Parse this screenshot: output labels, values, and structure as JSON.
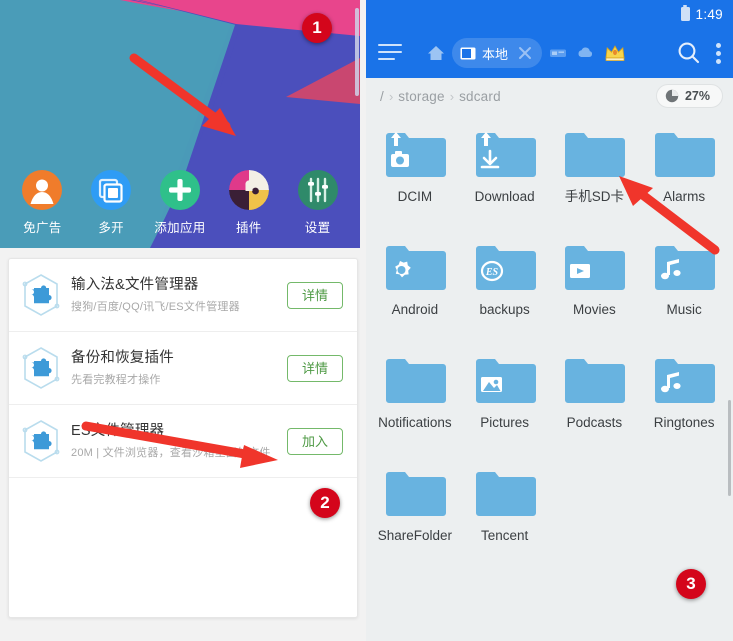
{
  "left_panel": {
    "hero": {
      "apps": [
        {
          "label": "免广告",
          "icon": "user-avatar-icon",
          "color": "#f07c2b"
        },
        {
          "label": "多开",
          "icon": "multi-window-icon",
          "color": "#2f9cf5"
        },
        {
          "label": "添加应用",
          "icon": "plus-icon",
          "color": "#2fc08a"
        },
        {
          "label": "插件",
          "icon": "puzzle-plugin-icon",
          "color": "#e0398a"
        },
        {
          "label": "设置",
          "icon": "sliders-settings-icon",
          "color": "#2f8a6a"
        }
      ],
      "annotation_badge": "1"
    },
    "plugin_list": {
      "items": [
        {
          "title": "输入法&文件管理器",
          "subtitle": "搜狗/百度/QQ/讯飞/ES文件管理器",
          "button": "详情",
          "icon": "hex-puzzle-plugin-icon"
        },
        {
          "title": "备份和恢复插件",
          "subtitle": "先看完教程才操作",
          "button": "详情",
          "icon": "hex-puzzle-plugin-icon"
        },
        {
          "title": "ES文件管理器",
          "subtitle": "20M | 文件浏览器，查看沙箱里面的文件",
          "button": "加入",
          "icon": "hex-puzzle-plugin-icon"
        }
      ],
      "annotation_badge": "2"
    }
  },
  "right_panel": {
    "statusbar": {
      "time": "1:49",
      "battery_icon": "battery-icon"
    },
    "toolbar": {
      "menu_icon": "hamburger-menu-icon",
      "home_icon": "home-icon",
      "tab": {
        "label": "本地",
        "icon": "device-local-icon",
        "close_icon": "close-icon"
      },
      "lan_icon": "network-lan-icon",
      "cloud_icon": "cloud-icon",
      "vip_icon": "crown-vip-icon",
      "search_icon": "search-icon",
      "more_icon": "more-vertical-icon"
    },
    "pathbar": {
      "crumbs": [
        "/",
        "storage",
        "sdcard"
      ],
      "separator": "›",
      "storage": {
        "percent": "27%",
        "icon": "pie-chart-icon"
      }
    },
    "files": [
      {
        "name": "DCIM",
        "icon": "folder-camera-icon"
      },
      {
        "name": "Download",
        "icon": "folder-download-icon"
      },
      {
        "name": "手机SD卡",
        "icon": "folder-icon"
      },
      {
        "name": "Alarms",
        "icon": "folder-icon"
      },
      {
        "name": "Android",
        "icon": "folder-gear-icon"
      },
      {
        "name": "backups",
        "icon": "folder-es-icon"
      },
      {
        "name": "Movies",
        "icon": "folder-video-icon"
      },
      {
        "name": "Music",
        "icon": "folder-music-icon"
      },
      {
        "name": "Notifications",
        "icon": "folder-icon"
      },
      {
        "name": "Pictures",
        "icon": "folder-image-icon"
      },
      {
        "name": "Podcasts",
        "icon": "folder-icon"
      },
      {
        "name": "Ringtones",
        "icon": "folder-music-icon"
      },
      {
        "name": "ShareFolder",
        "icon": "folder-icon"
      },
      {
        "name": "Tencent",
        "icon": "folder-icon"
      }
    ],
    "annotation_badge": "3"
  },
  "colors": {
    "accent_blue": "#1a73e8",
    "folder_blue": "#68b3e0",
    "badge_red": "#d4051b",
    "arrow_red": "#f0352b",
    "button_green": "#4f9a45",
    "hero_purple": "#4b4fbc",
    "hero_teal": "#4a9cb8",
    "hero_pink": "#e8458c"
  }
}
